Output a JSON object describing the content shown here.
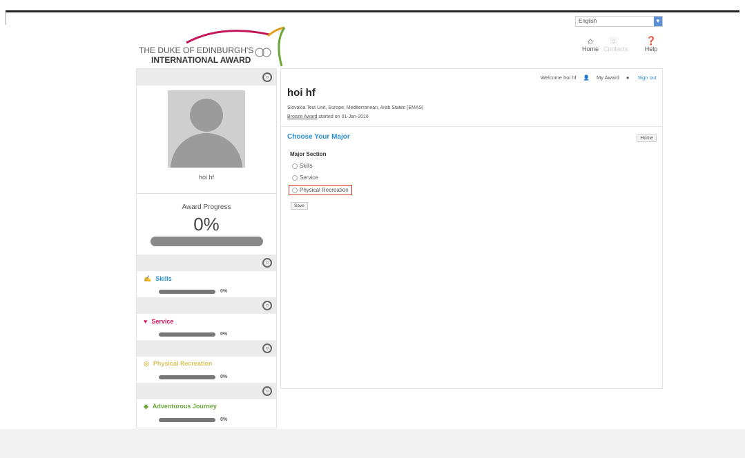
{
  "header": {
    "logo_line1": "THE DUKE OF EDINBURGH'S",
    "logo_line2": "INTERNATIONAL AWARD",
    "language": "English",
    "nav": [
      {
        "label": "Home",
        "icon": "home-icon"
      },
      {
        "label": "Contacts",
        "icon": "contacts-icon"
      },
      {
        "label": "Help",
        "icon": "help-icon"
      }
    ]
  },
  "sidebar": {
    "user_name": "hoi hf",
    "award_progress_title": "Award Progress",
    "award_progress_pct": "0%",
    "award_progress_value": 0,
    "sections": [
      {
        "label": "Skills",
        "pct": "0%",
        "color": "#2a8ed4",
        "icon": "skills-icon"
      },
      {
        "label": "Service",
        "pct": "0%",
        "color": "#d4145a",
        "icon": "service-icon"
      },
      {
        "label": "Physical Recreation",
        "pct": "0%",
        "color": "#d7c35a",
        "icon": "physical-recreation-icon"
      },
      {
        "label": "Adventurous Journey",
        "pct": "0%",
        "color": "#6aa83a",
        "icon": "adventurous-journey-icon"
      }
    ]
  },
  "topnav": {
    "welcome": "Welcome hoi hf",
    "my_award": "My Award",
    "sign_out": "Sign out"
  },
  "main": {
    "title": "hoi hf",
    "unit_line": "Slovakia Test Unit, Europe, Mediterranean, Arab States (EMAS)",
    "award_link": "Bronze Award",
    "award_started": "started on 01-Jan-2016",
    "section_heading": "Choose Your Major",
    "home_button": "Home",
    "major_label": "Major Section",
    "options": [
      "Skills",
      "Service",
      "Physical Recreation"
    ],
    "save_button": "Save"
  },
  "colors": {
    "accent_blue": "#2a8ed4",
    "highlight_red": "#d9322b"
  }
}
